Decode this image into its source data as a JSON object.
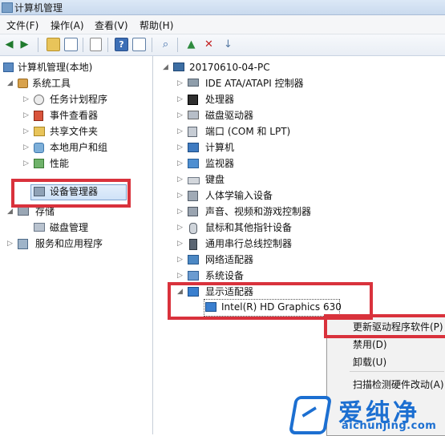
{
  "window": {
    "title": "计算机管理"
  },
  "menu": [
    "文件(F)",
    "操作(A)",
    "查看(V)",
    "帮助(H)"
  ],
  "toolbar": {
    "icons": [
      "back-arrow-icon",
      "forward-arrow-icon",
      "up-folder-icon",
      "show-hide-tree-icon",
      "properties-icon",
      "help-icon",
      "action-pane-icon",
      "scan-hardware-icon",
      "update-driver-icon",
      "uninstall-icon",
      "disable-icon"
    ]
  },
  "left_tree": {
    "root": "计算机管理(本地)",
    "system_tools": "系统工具",
    "tools_items": [
      "任务计划程序",
      "事件查看器",
      "共享文件夹",
      "本地用户和组",
      "性能",
      "设备管理器"
    ],
    "storage": "存储",
    "storage_items": [
      "磁盘管理"
    ],
    "services": "服务和应用程序"
  },
  "right_tree": {
    "root": "20170610-04-PC",
    "categories": [
      "IDE ATA/ATAPI 控制器",
      "处理器",
      "磁盘驱动器",
      "端口 (COM 和 LPT)",
      "计算机",
      "监视器",
      "键盘",
      "人体学输入设备",
      "声音、视频和游戏控制器",
      "鼠标和其他指针设备",
      "通用串行总线控制器",
      "网络适配器",
      "系统设备",
      "显示适配器"
    ],
    "display_child": "Intel(R) HD Graphics 630"
  },
  "context_menu": [
    "更新驱动程序软件(P)",
    "禁用(D)",
    "卸载(U)",
    "扫描检测硬件改动(A)"
  ],
  "watermark": {
    "brand": "爱纯净",
    "site": "aichunjing.com",
    "color": "#1c6fd1"
  },
  "accent_colors": {
    "highlight_red": "#d9323c",
    "selection_blue": "#cfe2f8"
  }
}
